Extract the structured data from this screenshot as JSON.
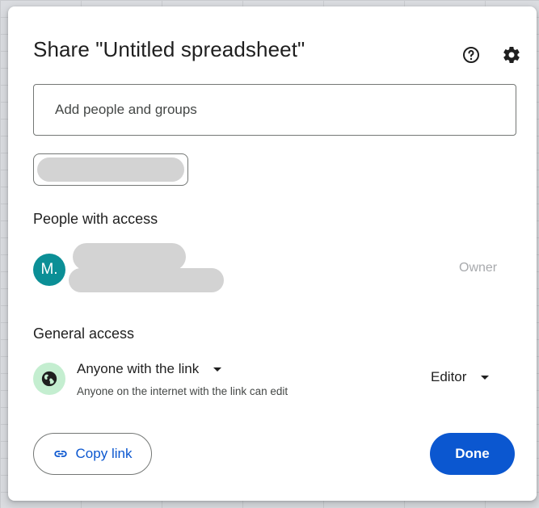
{
  "dialog": {
    "title": "Share \"Untitled spreadsheet\"",
    "help_icon": "help-circle-icon",
    "settings_icon": "gear-icon"
  },
  "add_people": {
    "placeholder": "Add people and groups",
    "value": ""
  },
  "people_with_access": {
    "heading": "People with access",
    "users": [
      {
        "initial": "M.",
        "role": "Owner",
        "avatar_color": "#0b8f96"
      }
    ]
  },
  "general_access": {
    "heading": "General access",
    "link_setting": "Anyone with the link",
    "description": "Anyone on the internet with the link can edit",
    "role": "Editor",
    "icon": "globe-icon",
    "icon_bg": "#c4eed0"
  },
  "footer": {
    "copy_link_label": "Copy link",
    "copy_link_icon": "link-icon",
    "done_label": "Done"
  },
  "colors": {
    "primary": "#0b57d0",
    "text": "#1f1f1f",
    "muted": "#a8aaad"
  }
}
